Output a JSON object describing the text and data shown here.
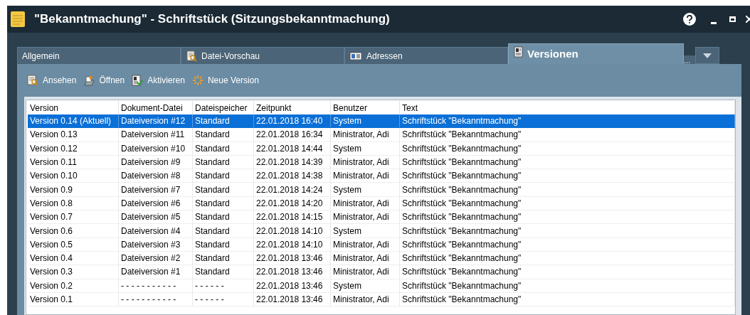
{
  "window": {
    "title": "\"Bekanntmachung\" - Schriftstück (Sitzungsbekanntmachung)"
  },
  "tabs": [
    {
      "label": "Allgemein",
      "selected": false
    },
    {
      "label": "Datei-Vorschau",
      "selected": false
    },
    {
      "label": "Adressen",
      "selected": false
    },
    {
      "label": "Versionen",
      "selected": true
    }
  ],
  "tab_overflow": "...",
  "toolbar": [
    {
      "label": "Ansehen"
    },
    {
      "label": "Öffnen"
    },
    {
      "label": "Aktivieren"
    },
    {
      "label": "Neue Version"
    }
  ],
  "table": {
    "columns": [
      "Version",
      "Dokument-Datei",
      "Dateispeicher",
      "Zeitpunkt",
      "Benutzer",
      "Text"
    ],
    "rows": [
      {
        "cells": [
          "Version 0.14 (Aktuell)",
          "Dateiversion #12",
          "Standard",
          "22.01.2018 16:40",
          "System",
          "Schriftstück \"Bekanntmachung\""
        ],
        "selected": true
      },
      {
        "cells": [
          "Version 0.13",
          "Dateiversion #11",
          "Standard",
          "22.01.2018 16:34",
          "Ministrator, Adi",
          "Schriftstück \"Bekanntmachung\""
        ],
        "selected": false
      },
      {
        "cells": [
          "Version 0.12",
          "Dateiversion #10",
          "Standard",
          "22.01.2018 14:44",
          "System",
          "Schriftstück \"Bekanntmachung\""
        ],
        "selected": false
      },
      {
        "cells": [
          "Version 0.11",
          "Dateiversion #9",
          "Standard",
          "22.01.2018 14:39",
          "Ministrator, Adi",
          "Schriftstück \"Bekanntmachung\""
        ],
        "selected": false
      },
      {
        "cells": [
          "Version 0.10",
          "Dateiversion #8",
          "Standard",
          "22.01.2018 14:38",
          "Ministrator, Adi",
          "Schriftstück \"Bekanntmachung\""
        ],
        "selected": false
      },
      {
        "cells": [
          "Version 0.9",
          "Dateiversion #7",
          "Standard",
          "22.01.2018 14:24",
          "System",
          "Schriftstück \"Bekanntmachung\""
        ],
        "selected": false
      },
      {
        "cells": [
          "Version 0.8",
          "Dateiversion #6",
          "Standard",
          "22.01.2018 14:20",
          "Ministrator, Adi",
          "Schriftstück \"Bekanntmachung\""
        ],
        "selected": false
      },
      {
        "cells": [
          "Version 0.7",
          "Dateiversion #5",
          "Standard",
          "22.01.2018 14:15",
          "Ministrator, Adi",
          "Schriftstück \"Bekanntmachung\""
        ],
        "selected": false
      },
      {
        "cells": [
          "Version 0.6",
          "Dateiversion #4",
          "Standard",
          "22.01.2018 14:10",
          "System",
          "Schriftstück \"Bekanntmachung\""
        ],
        "selected": false
      },
      {
        "cells": [
          "Version 0.5",
          "Dateiversion #3",
          "Standard",
          "22.01.2018 14:10",
          "Ministrator, Adi",
          "Schriftstück \"Bekanntmachung\""
        ],
        "selected": false
      },
      {
        "cells": [
          "Version 0.4",
          "Dateiversion #2",
          "Standard",
          "22.01.2018 13:46",
          "Ministrator, Adi",
          "Schriftstück \"Bekanntmachung\""
        ],
        "selected": false
      },
      {
        "cells": [
          "Version 0.3",
          "Dateiversion #1",
          "Standard",
          "22.01.2018 13:46",
          "Ministrator, Adi",
          "Schriftstück \"Bekanntmachung\""
        ],
        "selected": false
      },
      {
        "cells": [
          "Version 0.2",
          "- - - - - - - - - - -",
          "- - - - - -",
          "22.01.2018 13:46",
          "System",
          "Schriftstück \"Bekanntmachung\""
        ],
        "selected": false
      },
      {
        "cells": [
          "Version 0.1",
          "- - - - - - - - - - -",
          "- - - - - -",
          "22.01.2018 13:46",
          "Ministrator, Adi",
          "Schriftstück \"Bekanntmachung\""
        ],
        "selected": false
      }
    ]
  }
}
